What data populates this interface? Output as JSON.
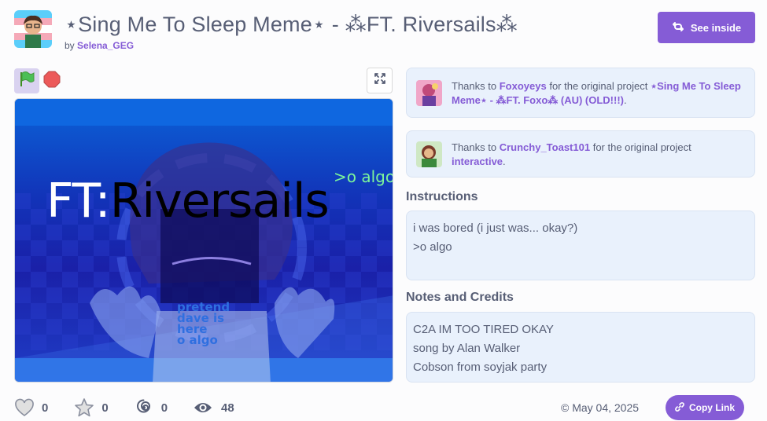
{
  "project": {
    "title": "⋆Sing Me To Sleep Meme⋆ - ⁂FT. Riversails⁂",
    "by_prefix": "by",
    "author": "Selena_GEG"
  },
  "actions": {
    "see_inside": "See inside",
    "copy_link": "Copy Link"
  },
  "stage": {
    "title_ft": "FT:",
    "title_name": "Riversails",
    "tag": ">o algo",
    "shirt_text": [
      "pretend",
      "dave is",
      "here",
      "o algo"
    ]
  },
  "credits": [
    {
      "prefix": "Thanks to",
      "user": "Foxoyeys",
      "middle": "for the original project",
      "project": "⋆Sing Me To Sleep Meme⋆ - ⁂FT. Foxo⁂ (AU) (OLD!!!)",
      "suffix": "."
    },
    {
      "prefix": "Thanks to",
      "user": "Crunchy_Toast101",
      "middle": "for the original project",
      "project": "interactive",
      "suffix": "."
    }
  ],
  "instructions": {
    "heading": "Instructions",
    "lines": [
      "i was bored (i just was... okay?)",
      ">o algo"
    ]
  },
  "notes": {
    "heading": "Notes and Credits",
    "lines": [
      "C2A IM TOO TIRED OKAY",
      "song by Alan Walker",
      "Cobson from soyjak party"
    ]
  },
  "stats": {
    "loves": "0",
    "favorites": "0",
    "remixes": "0",
    "views": "48"
  },
  "date": "© May 04, 2025",
  "colors": {
    "accent": "#855cd6",
    "text": "#575e75",
    "panel": "#e9f1fc"
  },
  "icons": [
    "green-flag-icon",
    "stop-icon",
    "fullscreen-icon",
    "remix-icon",
    "heart-icon",
    "star-icon",
    "spiral-icon",
    "eye-icon",
    "link-icon"
  ]
}
